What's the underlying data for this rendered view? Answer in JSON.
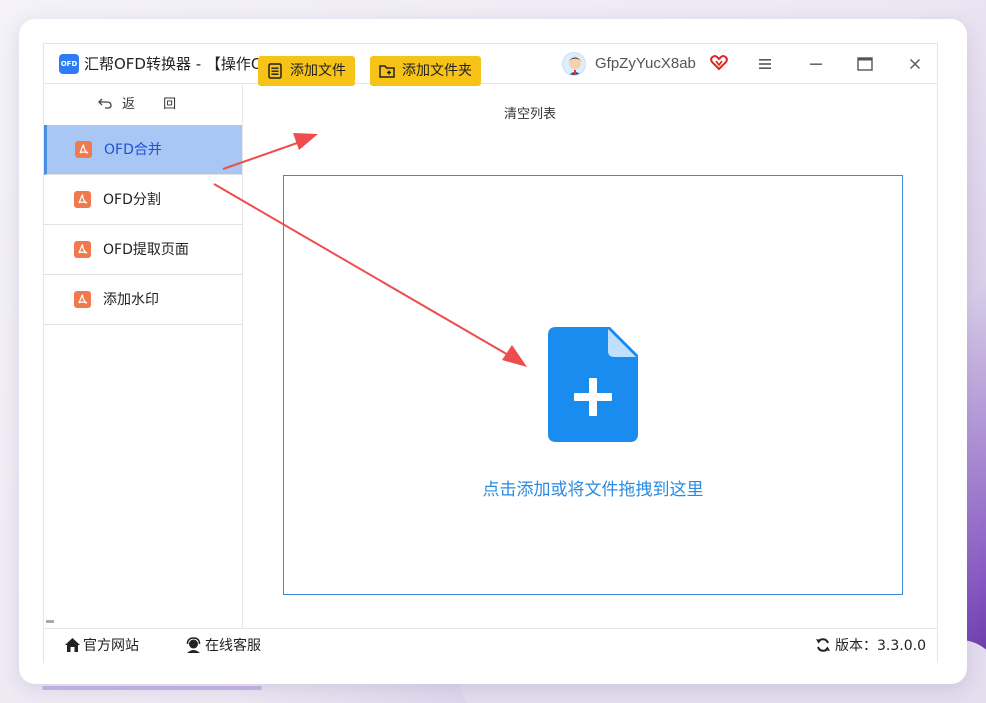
{
  "window": {
    "logo_text": "OFD",
    "title": "汇帮OFD转换器 - 【操作OFD文件】",
    "username": "GfpZyYucX8ab"
  },
  "sidebar": {
    "back_label": "返 回",
    "items": [
      {
        "label": "OFD合并",
        "active": true
      },
      {
        "label": "OFD分割",
        "active": false
      },
      {
        "label": "OFD提取页面",
        "active": false
      },
      {
        "label": "添加水印",
        "active": false
      }
    ]
  },
  "toolbar": {
    "add_file_label": "添加文件",
    "add_folder_label": "添加文件夹",
    "clear_label": "清空列表"
  },
  "dropzone": {
    "hint": "点击添加或将文件拖拽到这里"
  },
  "footer": {
    "website_label": "官方网站",
    "support_label": "在线客服",
    "version_label": "版本：3.3.0.0"
  },
  "colors": {
    "accent": "#2a8be0",
    "toolbar_button": "#f7c318",
    "active_nav": "#a9c7f5",
    "nav_icon": "#f07a4d",
    "annotation_arrow": "#ee4d4d"
  }
}
